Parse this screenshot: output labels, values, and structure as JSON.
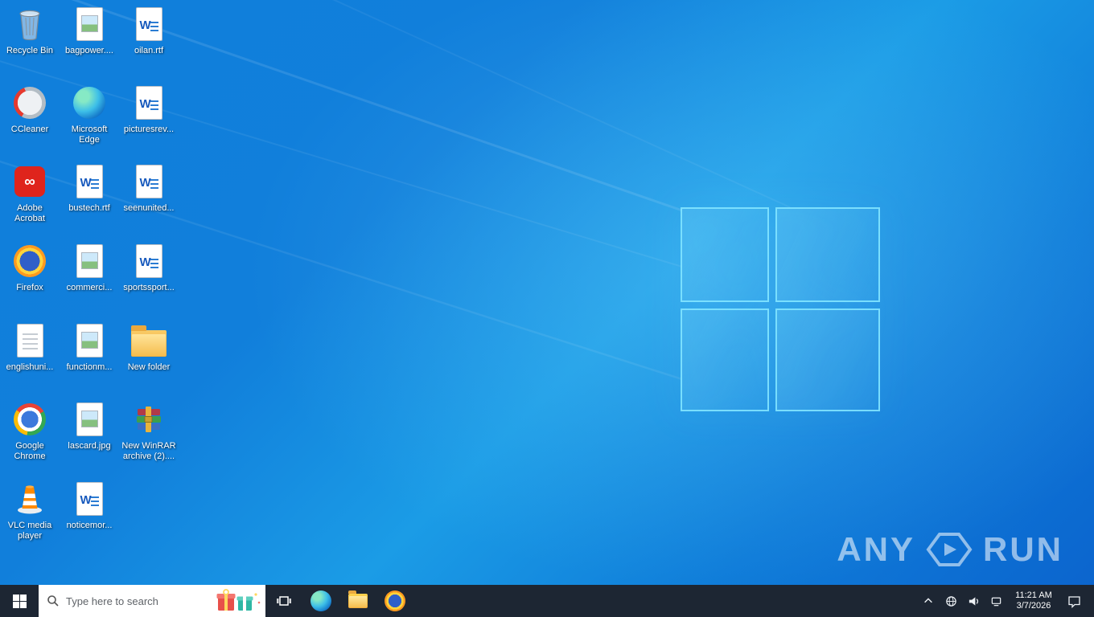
{
  "desktop": {
    "icons": [
      {
        "label": "Recycle Bin",
        "type": "recycle-bin"
      },
      {
        "label": "bagpower....",
        "type": "image-file"
      },
      {
        "label": "oilan.rtf",
        "type": "word-document"
      },
      {
        "label": "CCleaner",
        "type": "app-ccleaner"
      },
      {
        "label": "Microsoft Edge",
        "type": "app-edge"
      },
      {
        "label": "picturesrev...",
        "type": "word-document"
      },
      {
        "label": "Adobe Acrobat",
        "type": "app-acrobat"
      },
      {
        "label": "bustech.rtf",
        "type": "word-document"
      },
      {
        "label": "seenunited...",
        "type": "word-document"
      },
      {
        "label": "Firefox",
        "type": "app-firefox"
      },
      {
        "label": "commerci...",
        "type": "image-file"
      },
      {
        "label": "sportssport...",
        "type": "word-document"
      },
      {
        "label": "englishuni...",
        "type": "generic-file"
      },
      {
        "label": "functionm...",
        "type": "image-file"
      },
      {
        "label": "New folder",
        "type": "folder"
      },
      {
        "label": "Google Chrome",
        "type": "app-chrome"
      },
      {
        "label": "lascard.jpg",
        "type": "image-file"
      },
      {
        "label": "New WinRAR archive (2)....",
        "type": "winrar-archive"
      },
      {
        "label": "VLC media player",
        "type": "app-vlc"
      },
      {
        "label": "noticemor...",
        "type": "word-document"
      }
    ],
    "wallpaper": {
      "base_color": "#117fdb",
      "logo_line_color": "#82e4ff"
    }
  },
  "taskbar": {
    "color": "#1d2633",
    "search_placeholder": "Type here to search",
    "app_icons": [
      "start",
      "task-view",
      "microsoft-edge",
      "file-explorer",
      "firefox"
    ],
    "tray": {
      "icons": [
        "hidden-icons-chevron",
        "globe",
        "volume",
        "network",
        "action-center"
      ],
      "time": "11:21 AM",
      "date": "3/7/2026"
    }
  },
  "watermark": {
    "left": "ANY",
    "right": "RUN"
  }
}
